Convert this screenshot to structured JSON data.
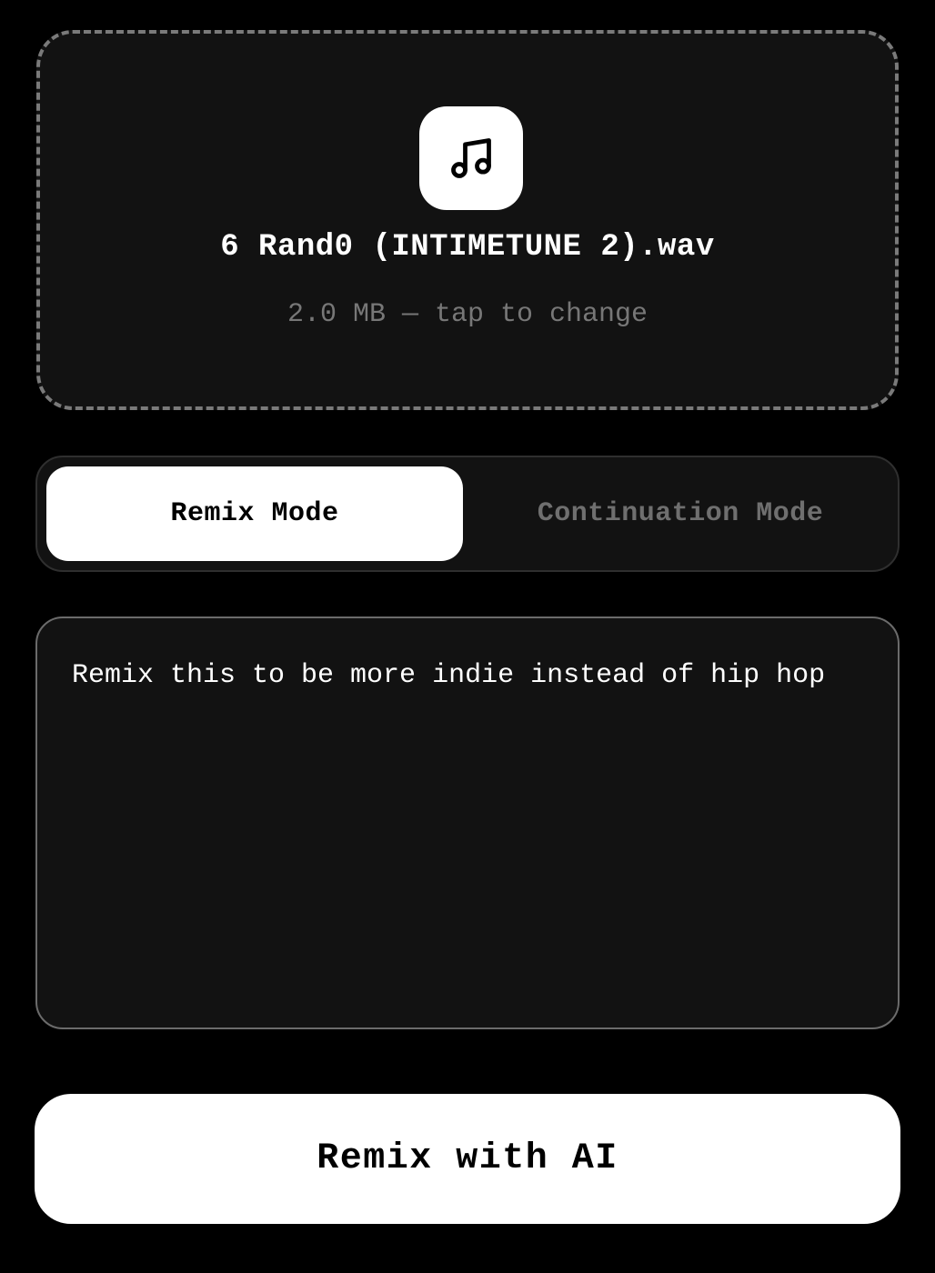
{
  "upload": {
    "icon": "music-note-icon",
    "file_name": "6 Rand0 (INTIMETUNE 2).wav",
    "file_meta": "2.0 MB — tap to change"
  },
  "mode_switch": {
    "selected": "Remix Mode",
    "options": [
      {
        "label": "Remix Mode",
        "active": true
      },
      {
        "label": "Continuation Mode",
        "active": false
      }
    ]
  },
  "prompt": {
    "value": "Remix this to be more indie instead of hip hop"
  },
  "actions": {
    "primary_label": "Remix with AI"
  },
  "colors": {
    "background": "#000000",
    "surface": "#121212",
    "accent": "#ffffff",
    "muted_text": "#777777"
  }
}
